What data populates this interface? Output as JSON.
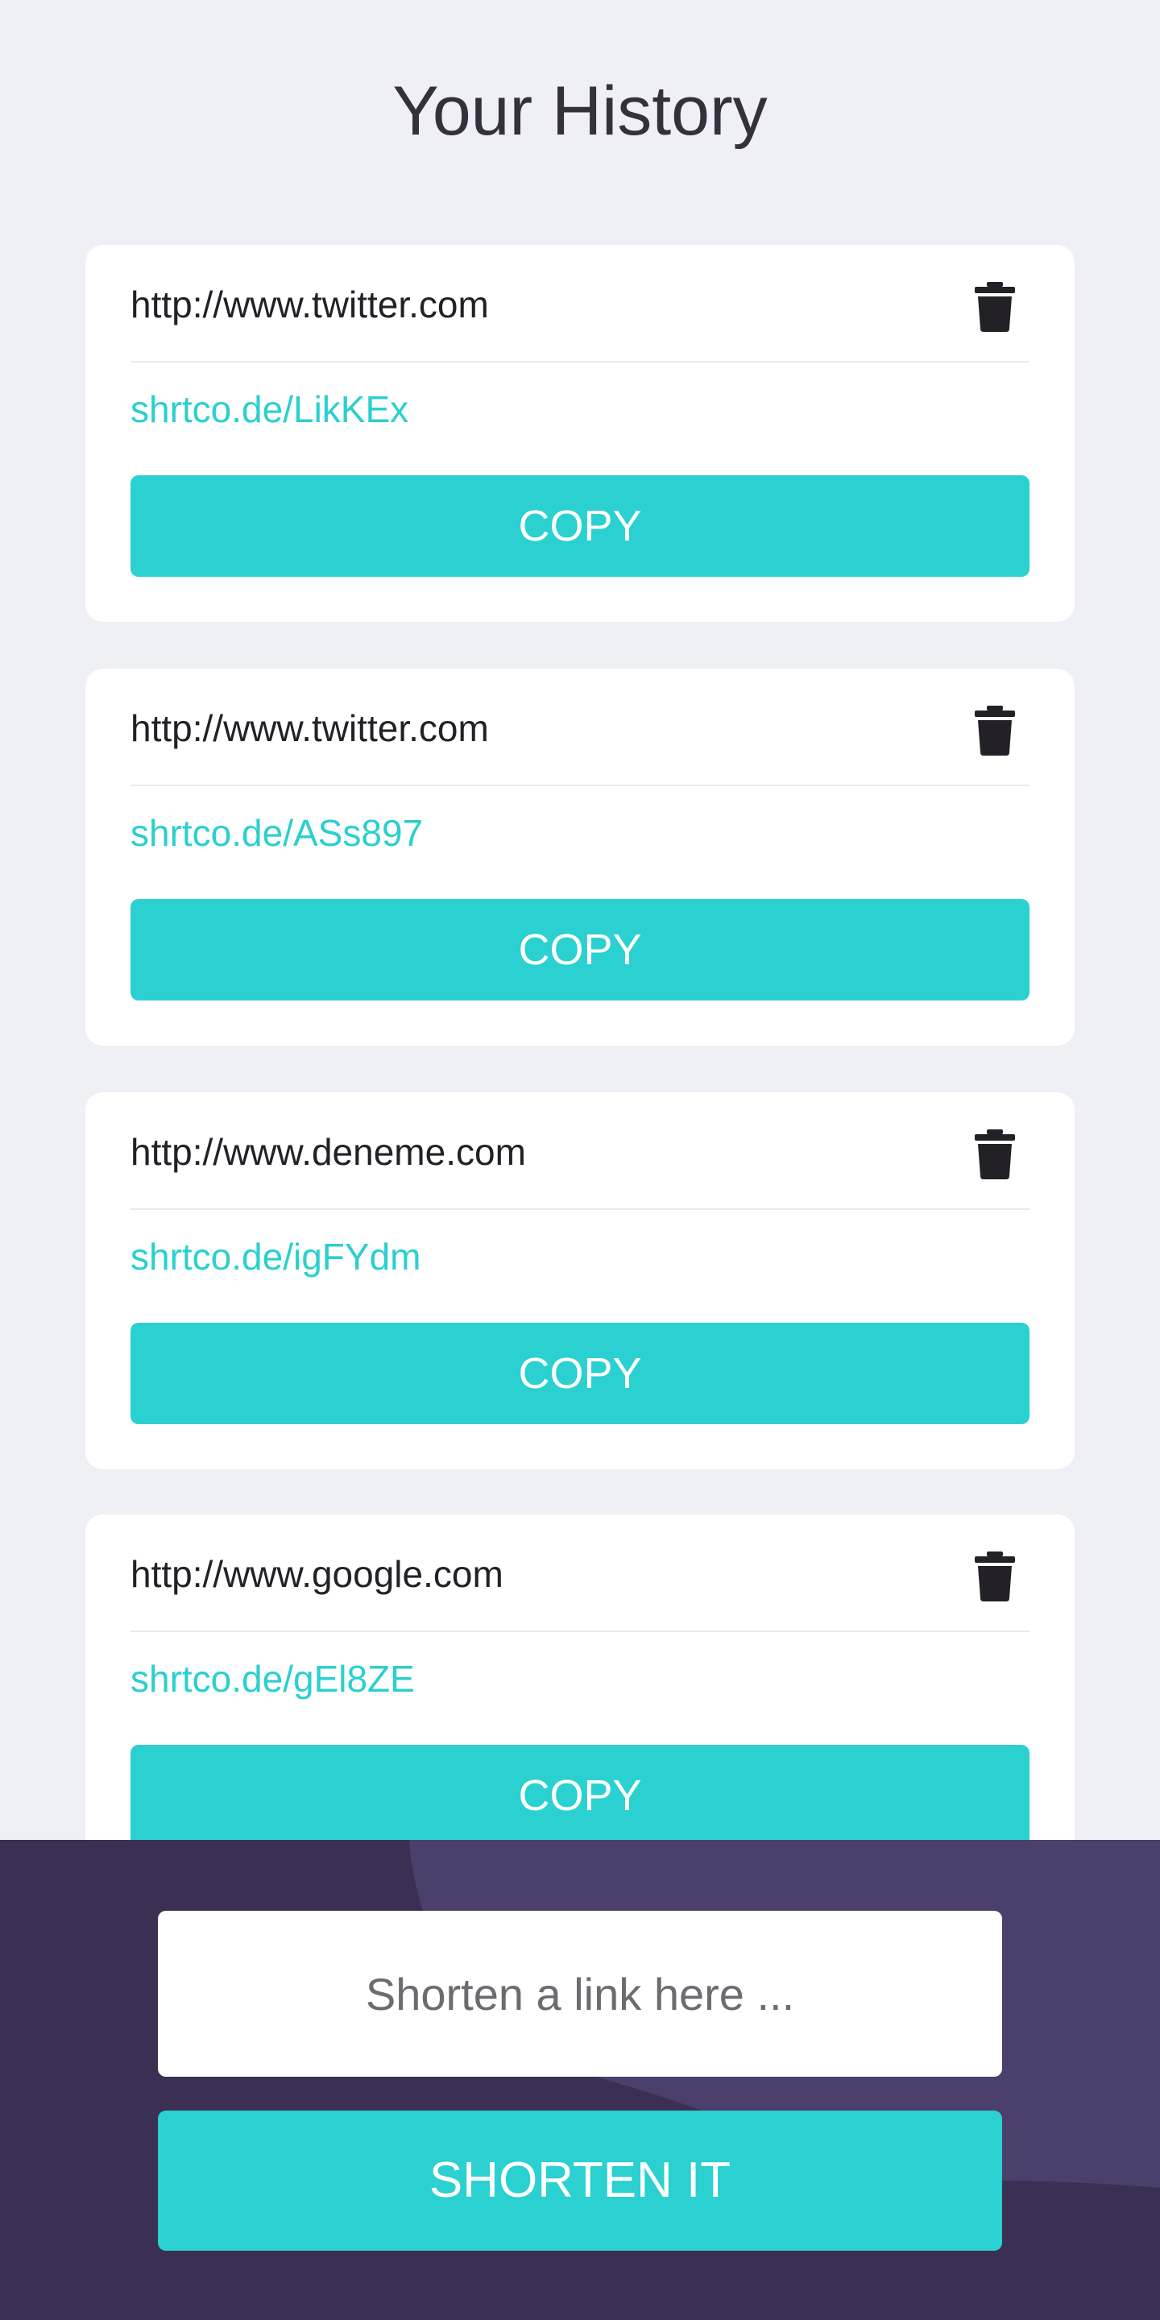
{
  "page": {
    "title": "Your History"
  },
  "colors": {
    "accent": "#2bd0d0",
    "short_link": "#2bcfcf",
    "panel_bg": "#3b3054",
    "panel_shape": "#4b3f6b",
    "page_bg": "#eff0f5",
    "card_bg": "#ffffff",
    "trash_icon": "#232127"
  },
  "history": {
    "items": [
      {
        "original_url": "http://www.twitter.com",
        "short_url": "shrtco.de/LikKEx",
        "copy_label": "COPY",
        "delete_icon": "trash-icon"
      },
      {
        "original_url": "http://www.twitter.com",
        "short_url": "shrtco.de/ASs897",
        "copy_label": "COPY",
        "delete_icon": "trash-icon"
      },
      {
        "original_url": "http://www.deneme.com",
        "short_url": "shrtco.de/igFYdm",
        "copy_label": "COPY",
        "delete_icon": "trash-icon"
      },
      {
        "original_url": "http://www.google.com",
        "short_url": "shrtco.de/gEl8ZE",
        "copy_label": "COPY",
        "delete_icon": "trash-icon"
      }
    ]
  },
  "shortener": {
    "input_value": "",
    "input_placeholder": "Shorten a link here ...",
    "button_label": "SHORTEN IT"
  }
}
